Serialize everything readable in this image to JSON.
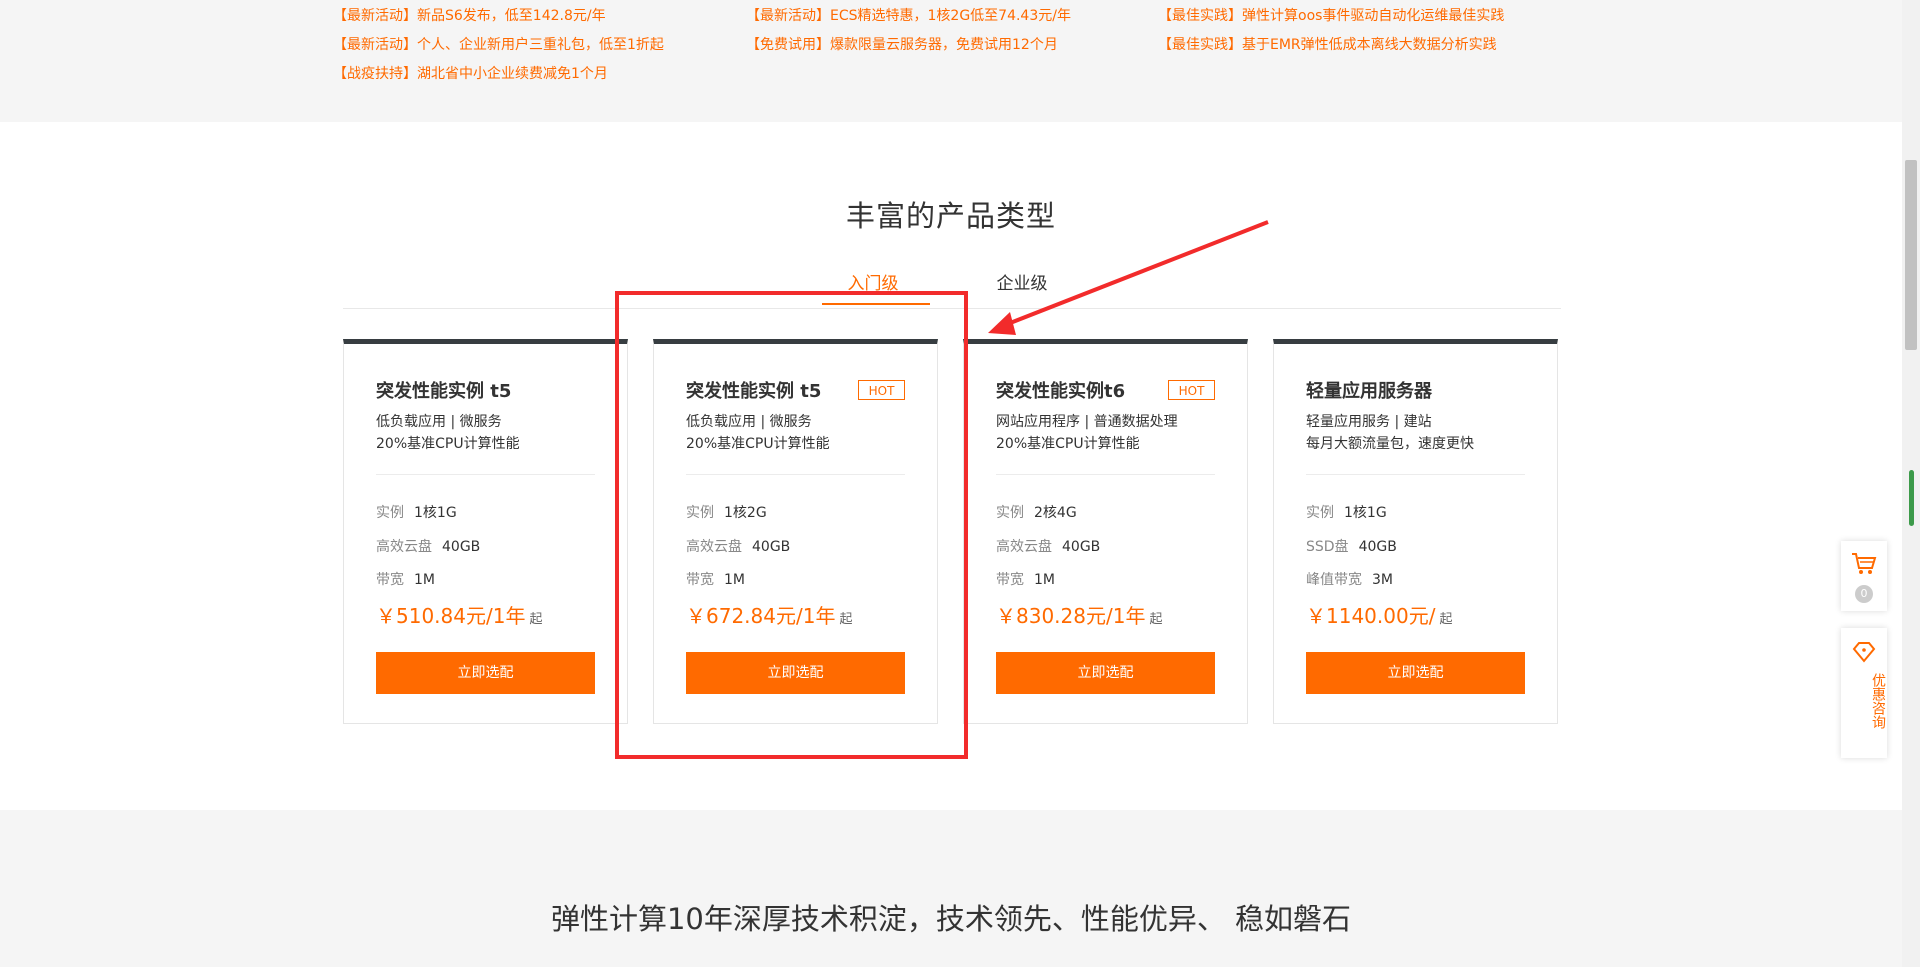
{
  "promos": {
    "col1": [
      "【最新活动】新品S6发布，低至142.8元/年",
      "【最新活动】个人、企业新用户三重礼包，低至1折起",
      "【战疫扶持】湖北省中小企业续费减免1个月"
    ],
    "col2": [
      "【最新活动】ECS精选特惠，1核2G低至74.43元/年",
      "【免费试用】爆款限量云服务器，免费试用12个月"
    ],
    "col3": [
      "【最佳实践】弹性计算oos事件驱动自动化运维最佳实践",
      "【最佳实践】基于EMR弹性低成本离线大数据分析实践"
    ]
  },
  "section": {
    "title": "丰富的产品类型",
    "tabs": [
      "入门级",
      "企业级"
    ]
  },
  "cards": [
    {
      "title": "突发性能实例 t5",
      "badge": "",
      "desc": [
        "低负载应用 | 微服务",
        "20%基准CPU计算性能"
      ],
      "specs": [
        {
          "label": "实例",
          "value": "1核1G"
        },
        {
          "label": "高效云盘",
          "value": "40GB"
        },
        {
          "label": "带宽",
          "value": "1M"
        }
      ],
      "price": "￥510.84元/1年",
      "price_suffix": "起",
      "button": "立即选配"
    },
    {
      "title": "突发性能实例 t5",
      "badge": "HOT",
      "desc": [
        "低负载应用 | 微服务",
        "20%基准CPU计算性能"
      ],
      "specs": [
        {
          "label": "实例",
          "value": "1核2G"
        },
        {
          "label": "高效云盘",
          "value": "40GB"
        },
        {
          "label": "带宽",
          "value": "1M"
        }
      ],
      "price": "￥672.84元/1年",
      "price_suffix": "起",
      "button": "立即选配"
    },
    {
      "title": "突发性能实例t6",
      "badge": "HOT",
      "desc": [
        "网站应用程序 | 普通数据处理",
        "20%基准CPU计算性能"
      ],
      "specs": [
        {
          "label": "实例",
          "value": "2核4G"
        },
        {
          "label": "高效云盘",
          "value": "40GB"
        },
        {
          "label": "带宽",
          "value": "1M"
        }
      ],
      "price": "￥830.28元/1年",
      "price_suffix": "起",
      "button": "立即选配"
    },
    {
      "title": "轻量应用服务器",
      "badge": "",
      "desc": [
        "轻量应用服务 | 建站",
        "每月大额流量包，速度更快"
      ],
      "specs": [
        {
          "label": "实例",
          "value": "1核1G"
        },
        {
          "label": "SSD盘",
          "value": "40GB"
        },
        {
          "label": "峰值带宽",
          "value": "3M"
        }
      ],
      "price": "￥1140.00元/",
      "price_suffix": "起",
      "button": "立即选配"
    }
  ],
  "lower_section": {
    "title": "弹性计算10年深厚技术积淀，技术领先、性能优异、 稳如磐石"
  },
  "side_widgets": {
    "cart_count": "0",
    "consult_label": "优惠咨询"
  },
  "colors": {
    "accent": "#ff6a00",
    "annotation": "#f22b2b",
    "card_top": "#373d41"
  }
}
